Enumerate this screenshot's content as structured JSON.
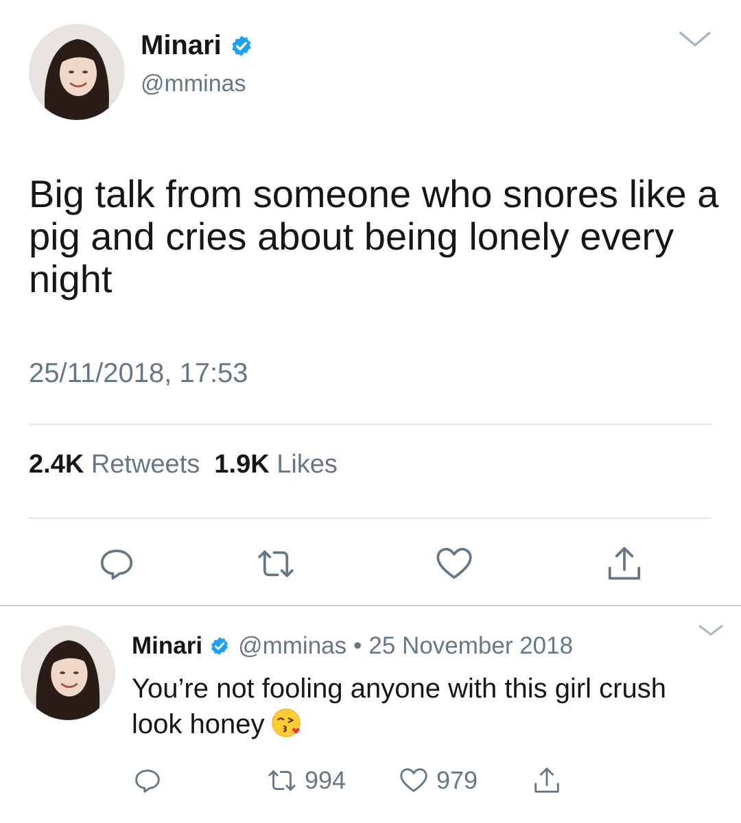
{
  "main_tweet": {
    "display_name": "Minari",
    "handle": "@mminas",
    "text": "Big talk from someone who snores like a pig and cries about being lonely every night",
    "timestamp": "25/11/2018, 17:53",
    "retweets_count": "2.4K",
    "retweets_label": "Retweets",
    "likes_count": "1.9K",
    "likes_label": "Likes"
  },
  "reply_tweet": {
    "display_name": "Minari",
    "handle": "@mminas",
    "separator": "•",
    "date": "25 November 2018",
    "text": "You’re not fooling anyone with this girl crush look honey",
    "emoji": "😘",
    "retweet_count": "994",
    "like_count": "979"
  },
  "colors": {
    "verified_blue": "#1da1f2",
    "secondary_text": "#657786",
    "primary_text": "#14171a",
    "icon_gray": "#657786"
  }
}
